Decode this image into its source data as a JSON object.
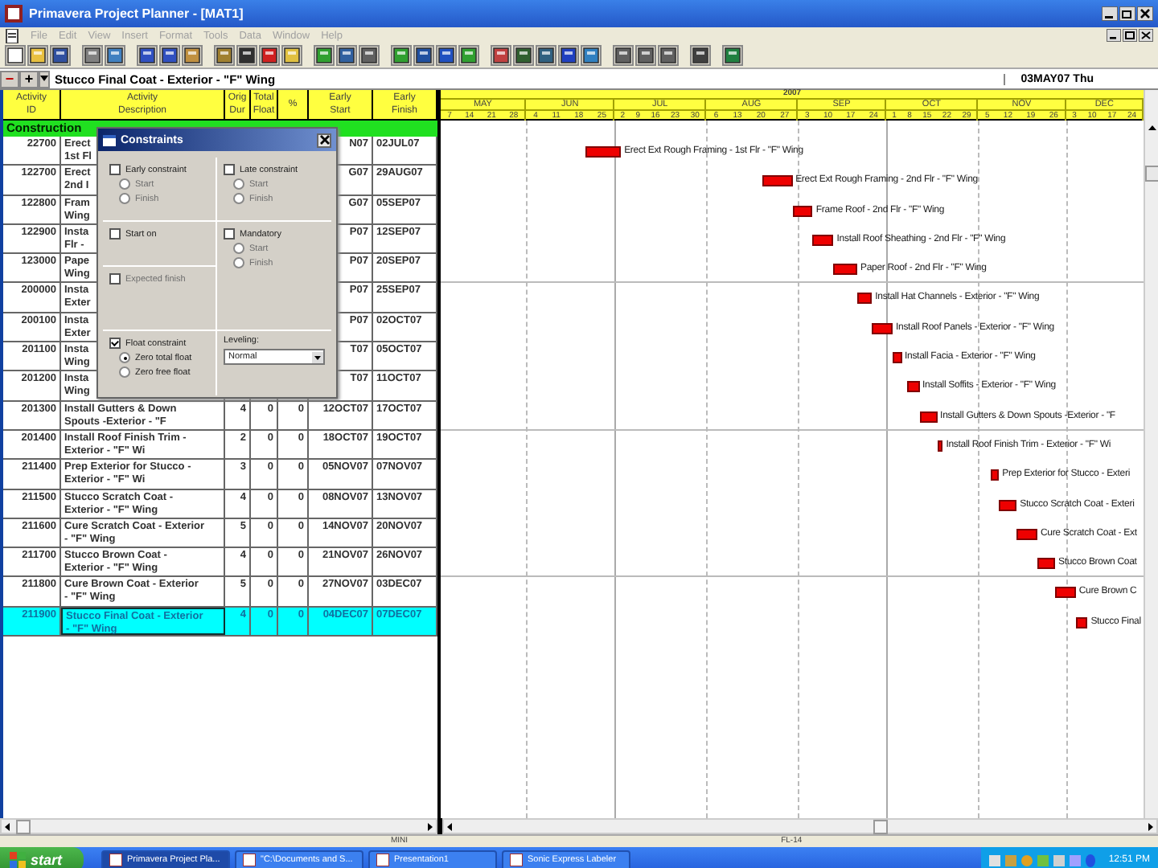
{
  "window": {
    "title": "Primavera Project Planner - [MAT1]"
  },
  "menu": [
    {
      "label": "File",
      "disabled": true
    },
    {
      "label": "Edit",
      "disabled": true
    },
    {
      "label": "View",
      "disabled": true
    },
    {
      "label": "Insert",
      "disabled": true
    },
    {
      "label": "Format",
      "disabled": true
    },
    {
      "label": "Tools",
      "disabled": true
    },
    {
      "label": "Data",
      "disabled": true
    },
    {
      "label": "Window",
      "disabled": true
    },
    {
      "label": "Help",
      "disabled": true
    }
  ],
  "edit_bar": {
    "collapse": "−",
    "expand": "+",
    "activity": "Stucco Final Coat - Exterior - \"F\" Wing",
    "date": "03MAY07 Thu"
  },
  "table": {
    "columns": [
      "Activity\nID",
      "Activity\nDescription",
      "Orig\nDur",
      "Total\nFloat",
      "%",
      "Early\nStart",
      "Early\nFinish"
    ],
    "group": "Construction",
    "rows": [
      {
        "id": "22700",
        "description": "Erect\n1st Fl",
        "start": "N07",
        "finish": "02JUL07",
        "selected": false,
        "bar_label": "Erect Ext Rough Framing - 1st Flr - \"F\" Wing"
      },
      {
        "id": "122700",
        "description": "Erect\n2nd I",
        "start": "G07",
        "finish": "29AUG07",
        "selected": false,
        "bar_label": "Erect Ext Rough Framing - 2nd Flr - \"F\" Wing"
      },
      {
        "id": "122800",
        "description": "Fram\nWing",
        "start": "G07",
        "finish": "05SEP07",
        "selected": false,
        "bar_label": "Frame Roof - 2nd Flr - \"F\" Wing"
      },
      {
        "id": "122900",
        "description": "Insta\nFlr -",
        "start": "P07",
        "finish": "12SEP07",
        "selected": false,
        "bar_label": "Install Roof Sheathing - 2nd Flr - \"F\" Wing"
      },
      {
        "id": "123000",
        "description": "Pape\nWing",
        "start": "P07",
        "finish": "20SEP07",
        "selected": false,
        "bar_label": "Paper Roof - 2nd Flr - \"F\" Wing"
      },
      {
        "id": "200000",
        "description": "Insta\nExter",
        "start": "P07",
        "finish": "25SEP07",
        "selected": false,
        "bar_label": "Install Hat Channels - Exterior - \"F\" Wing"
      },
      {
        "id": "200100",
        "description": "Insta\nExter",
        "start": "P07",
        "finish": "02OCT07",
        "selected": false,
        "bar_label": "Install Roof Panels - Exterior - \"F\" Wing"
      },
      {
        "id": "201100",
        "description": "Insta\nWing",
        "start": "T07",
        "finish": "05OCT07",
        "selected": false,
        "bar_label": "Install Facia - Exterior - \"F\" Wing"
      },
      {
        "id": "201200",
        "description": "Insta\nWing",
        "start": "T07",
        "finish": "11OCT07",
        "selected": false,
        "bar_label": "Install Soffits - Exterior - \"F\" Wing"
      },
      {
        "id": "201300",
        "description": "Install Gutters & Down\nSpouts -Exterior - \"F",
        "dur": "4",
        "float": "0",
        "pct": "0",
        "start": "12OCT07",
        "finish": "17OCT07",
        "selected": false,
        "bar_label": "Install Gutters & Down Spouts -Exterior - \"F"
      },
      {
        "id": "201400",
        "description": "Install Roof Finish Trim -\nExterior - \"F\" Wi",
        "dur": "2",
        "float": "0",
        "pct": "0",
        "start": "18OCT07",
        "finish": "19OCT07",
        "selected": false,
        "bar_label": "Install Roof Finish Trim - Exterior - \"F\" Wi"
      },
      {
        "id": "211400",
        "description": "Prep Exterior for Stucco -\nExterior - \"F\" Wi",
        "dur": "3",
        "float": "0",
        "pct": "0",
        "start": "05NOV07",
        "finish": "07NOV07",
        "selected": false,
        "bar_label": "Prep Exterior for Stucco - Exteri"
      },
      {
        "id": "211500",
        "description": "Stucco Scratch Coat -\nExterior - \"F\" Wing",
        "dur": "4",
        "float": "0",
        "pct": "0",
        "start": "08NOV07",
        "finish": "13NOV07",
        "selected": false,
        "bar_label": "Stucco Scratch Coat - Exteri"
      },
      {
        "id": "211600",
        "description": "Cure Scratch Coat - Exterior\n- \"F\" Wing",
        "dur": "5",
        "float": "0",
        "pct": "0",
        "start": "14NOV07",
        "finish": "20NOV07",
        "selected": false,
        "bar_label": "Cure Scratch Coat - Ext"
      },
      {
        "id": "211700",
        "description": "Stucco Brown Coat -\nExterior - \"F\" Wing",
        "dur": "4",
        "float": "0",
        "pct": "0",
        "start": "21NOV07",
        "finish": "26NOV07",
        "selected": false,
        "bar_label": "Stucco Brown Coat"
      },
      {
        "id": "211800",
        "description": "Cure Brown Coat - Exterior\n- \"F\" Wing",
        "dur": "5",
        "float": "0",
        "pct": "0",
        "start": "27NOV07",
        "finish": "03DEC07",
        "selected": false,
        "bar_label": "Cure Brown C"
      },
      {
        "id": "211900",
        "description": "Stucco Final Coat - Exterior\n- \"F\" Wing",
        "dur": "4",
        "float": "0",
        "pct": "0",
        "start": "04DEC07",
        "finish": "07DEC07",
        "selected": true,
        "bar_label": "Stucco Final"
      }
    ]
  },
  "timescale": {
    "year": "2007",
    "months": [
      {
        "label": "MAY",
        "days": [
          "7",
          "14",
          "21",
          "28"
        ]
      },
      {
        "label": "JUN",
        "days": [
          "4",
          "11",
          "18",
          "25"
        ]
      },
      {
        "label": "JUL",
        "days": [
          "2",
          "9",
          "16",
          "23",
          "30"
        ]
      },
      {
        "label": "AUG",
        "days": [
          "6",
          "13",
          "20",
          "27"
        ]
      },
      {
        "label": "SEP",
        "days": [
          "3",
          "10",
          "17",
          "24"
        ]
      },
      {
        "label": "OCT",
        "days": [
          "1",
          "8",
          "15",
          "22",
          "29"
        ]
      },
      {
        "label": "NOV",
        "days": [
          "5",
          "12",
          "19",
          "26"
        ]
      },
      {
        "label": "DEC",
        "days": [
          "3",
          "10",
          "17",
          "24"
        ]
      }
    ]
  },
  "dialog": {
    "title": "Constraints",
    "early_constraint": {
      "label": "Early constraint",
      "checked": false,
      "options": [
        {
          "label": "Start",
          "selected": false,
          "disabled": true
        },
        {
          "label": "Finish",
          "selected": false,
          "disabled": true
        }
      ]
    },
    "late_constraint": {
      "label": "Late constraint",
      "checked": false,
      "options": [
        {
          "label": "Start",
          "selected": false,
          "disabled": true
        },
        {
          "label": "Finish",
          "selected": false,
          "disabled": true
        }
      ]
    },
    "start_on": {
      "label": "Start on",
      "checked": false
    },
    "mandatory": {
      "label": "Mandatory",
      "checked": false,
      "options": [
        {
          "label": "Start",
          "selected": false,
          "disabled": true
        },
        {
          "label": "Finish",
          "selected": false,
          "disabled": true
        }
      ]
    },
    "expected_finish": {
      "label": "Expected finish",
      "checked": false,
      "disabled": true
    },
    "float_constraint": {
      "label": "Float constraint",
      "checked": true,
      "options": [
        {
          "label": "Zero total float",
          "selected": true,
          "disabled": false
        },
        {
          "label": "Zero free float",
          "selected": false,
          "disabled": false
        }
      ]
    },
    "leveling": {
      "label": "Leveling:",
      "value": "Normal"
    }
  },
  "status_bar": [
    "MINI",
    "FL-14"
  ],
  "taskbar": {
    "start": "start",
    "tasks": [
      {
        "label": "Primavera Project Pla...",
        "selected": true
      },
      {
        "label": "\"C:\\Documents and S...",
        "selected": false
      },
      {
        "label": "Presentation1",
        "selected": false
      },
      {
        "label": "Sonic Express Labeler",
        "selected": false
      }
    ],
    "clock": "12:51 PM"
  }
}
